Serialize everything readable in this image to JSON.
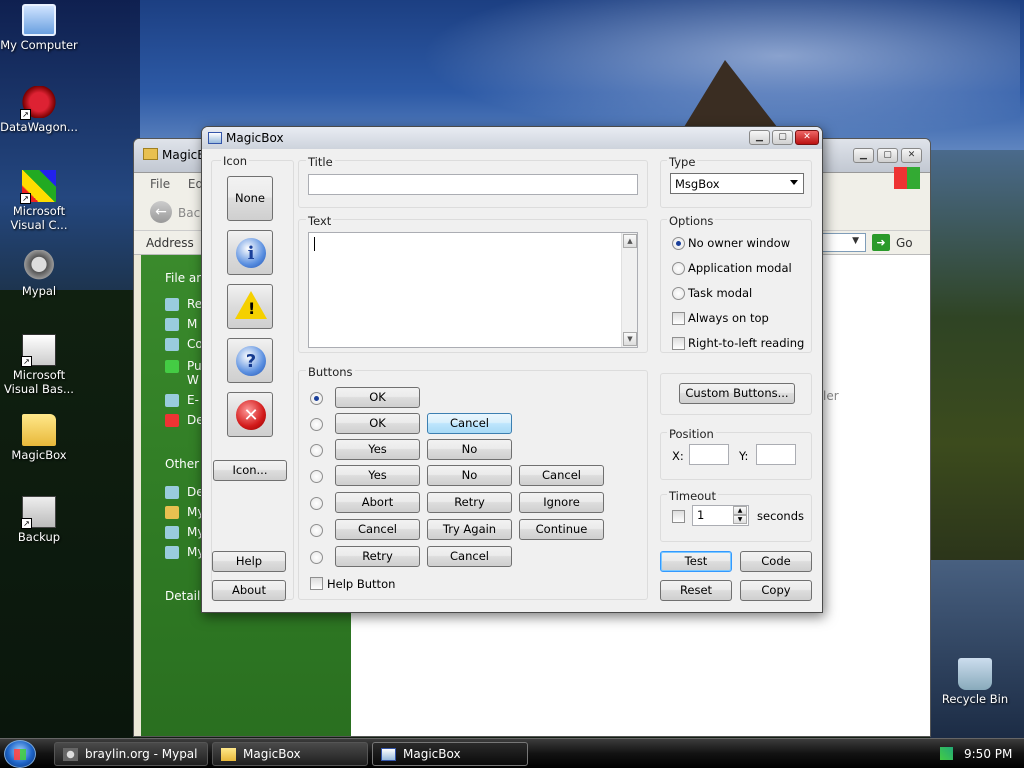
{
  "desktop": {
    "icons": [
      {
        "label": "My Computer",
        "icon": "computer-icon"
      },
      {
        "label": "DataWagon...",
        "icon": "datawagon-icon"
      },
      {
        "label": "Microsoft Visual C...",
        "icon": "visual-c-icon"
      },
      {
        "label": "Mypal",
        "icon": "mypal-icon"
      },
      {
        "label": "Microsoft Visual Bas...",
        "icon": "visual-basic-icon"
      },
      {
        "label": "MagicBox",
        "icon": "folder-icon"
      },
      {
        "label": "Backup",
        "icon": "backup-icon"
      },
      {
        "label": "Recycle Bin",
        "icon": "recycle-bin-icon"
      }
    ]
  },
  "explorer": {
    "title": "MagicB",
    "menu": [
      "File",
      "Edi"
    ],
    "back_label": "Back",
    "address_label": "Address",
    "go_label": "Go",
    "left_panel": {
      "file_section": "File and",
      "file_items": [
        "Re",
        "M",
        "Co",
        "Pu",
        "W",
        "E-",
        "De"
      ],
      "other_section": "Other P",
      "other_items": [
        "De",
        "My",
        "My",
        "My"
      ],
      "details_section": "Details"
    },
    "ghost_text": "ler"
  },
  "dialog": {
    "title": "MagicBox",
    "icon_group": {
      "label": "Icon",
      "none_label": "None",
      "icon_button_label": "Icon...",
      "icons": [
        "information-icon",
        "warning-icon",
        "question-icon",
        "error-icon"
      ],
      "warning_mark": "!",
      "info_mark": "i",
      "question_mark": "?",
      "error_mark": "✕"
    },
    "help_label": "Help",
    "about_label": "About",
    "title_group": {
      "label": "Title",
      "value": "",
      "placeholder": ""
    },
    "text_group": {
      "label": "Text",
      "value": ""
    },
    "buttons_group": {
      "label": "Buttons",
      "rows": [
        [
          "OK"
        ],
        [
          "OK",
          "Cancel"
        ],
        [
          "Yes",
          "No"
        ],
        [
          "Yes",
          "No",
          "Cancel"
        ],
        [
          "Abort",
          "Retry",
          "Ignore"
        ],
        [
          "Cancel",
          "Try Again",
          "Continue"
        ],
        [
          "Retry",
          "Cancel"
        ]
      ],
      "selected_row": 0,
      "help_button_label": "Help Button"
    },
    "type_group": {
      "label": "Type",
      "selected": "MsgBox"
    },
    "options_group": {
      "label": "Options",
      "radios": [
        {
          "label": "No owner window",
          "checked": true
        },
        {
          "label": "Application modal",
          "checked": false
        },
        {
          "label": "Task modal",
          "checked": false
        }
      ],
      "checks": [
        {
          "label": "Always on top",
          "checked": false
        },
        {
          "label": "Right-to-left reading",
          "checked": false
        }
      ]
    },
    "custom_buttons_label": "Custom Buttons...",
    "position_group": {
      "label": "Position",
      "x_label": "X:",
      "y_label": "Y:",
      "x_value": "",
      "y_value": ""
    },
    "timeout_group": {
      "label": "Timeout",
      "value": "1",
      "unit": "seconds",
      "enabled": false
    },
    "action_buttons": {
      "test": "Test",
      "code": "Code",
      "reset": "Reset",
      "copy": "Copy"
    }
  },
  "taskbar": {
    "items": [
      {
        "label": "braylin.org - Mypal",
        "icon": "mypal-icon"
      },
      {
        "label": "MagicBox",
        "icon": "folder-icon"
      },
      {
        "label": "MagicBox",
        "icon": "magicbox-icon",
        "active": true
      }
    ],
    "clock": "9:50 PM"
  }
}
